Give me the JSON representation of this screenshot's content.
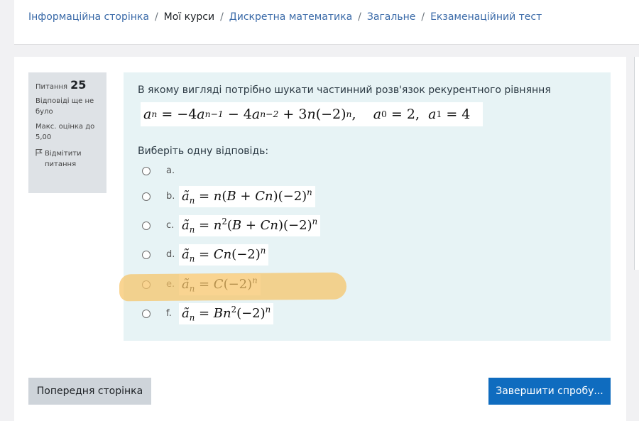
{
  "breadcrumb": {
    "items": [
      "Інформаційна сторінка",
      "Мої курси",
      "Дискретна математика",
      "Загальне",
      "Екзаменаційний тест"
    ],
    "separator": "/"
  },
  "question_info": {
    "label": "Питання",
    "number": "25",
    "status": "Відповіді ще не було",
    "max_grade": "Макс. оцінка до 5,00",
    "flag_label": "Відмітити питання"
  },
  "question": {
    "text": "В якому вигляді потрібно шукати частинний розв'язок рекурентного рівняння",
    "prompt": "Виберіть одну відповідь:",
    "options": [
      {
        "letter": "a.",
        "formula": ""
      },
      {
        "letter": "b.",
        "formula": "ã_n = n(B + Cn)(−2)^n"
      },
      {
        "letter": "c.",
        "formula": "ã_n = n²(B + Cn)(−2)^n"
      },
      {
        "letter": "d.",
        "formula": "ã_n = Cn(−2)^n"
      },
      {
        "letter": "e.",
        "formula": "ã_n = C(−2)^n"
      },
      {
        "letter": "f.",
        "formula": "ã_n = Bn²(−2)^n"
      }
    ],
    "highlighted_option": "e."
  },
  "buttons": {
    "prev": "Попередня сторінка",
    "finish": "Завершити спробу..."
  },
  "colors": {
    "accent": "#0f6cbf",
    "content_bg": "#e7f3f5",
    "info_bg": "#dee2e6",
    "highlight": "#f7c466"
  }
}
